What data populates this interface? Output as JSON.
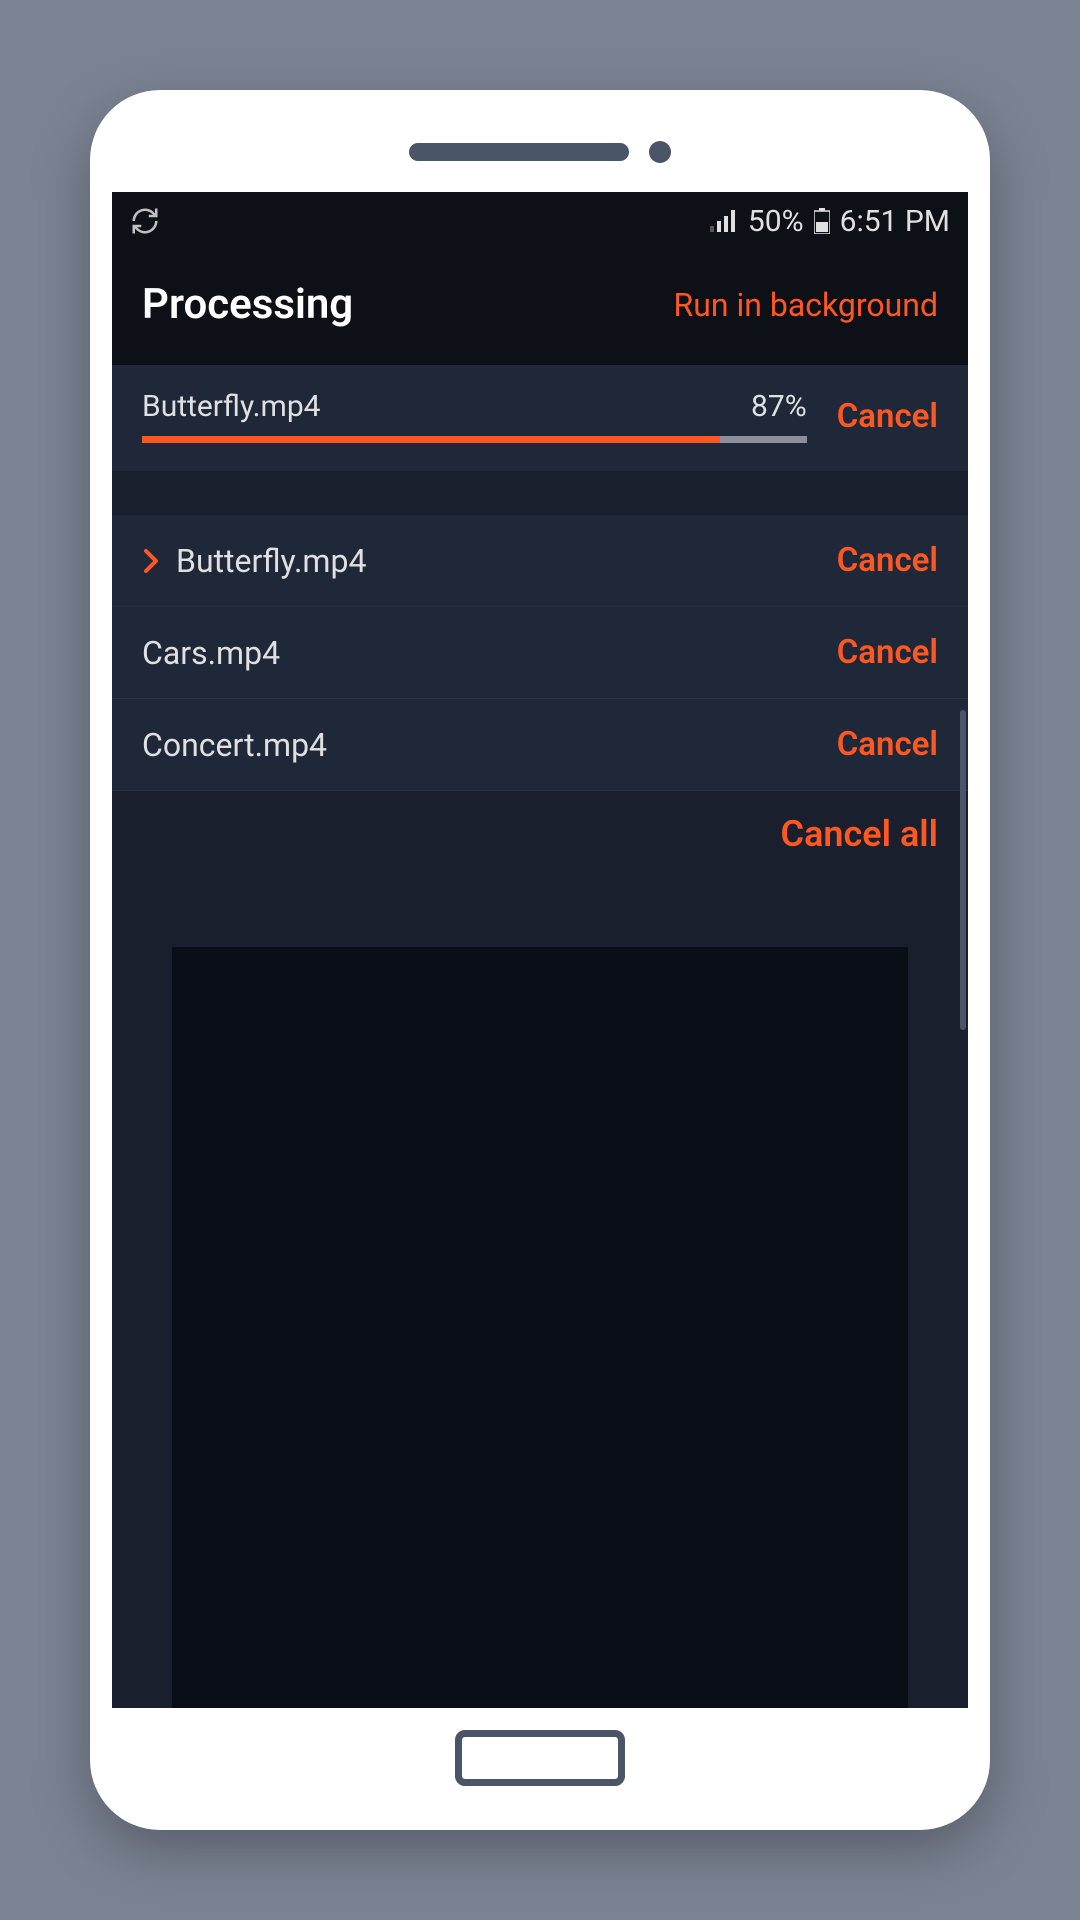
{
  "status_bar": {
    "battery_percent": "50%",
    "time": "6:51 PM"
  },
  "header": {
    "title": "Processing",
    "action": "Run in background"
  },
  "current": {
    "filename": "Butterfly.mp4",
    "percent_label": "87%",
    "percent_value": 87,
    "cancel_label": "Cancel"
  },
  "queue": [
    {
      "filename": "Butterfly.mp4",
      "cancel_label": "Cancel",
      "active": true
    },
    {
      "filename": "Cars.mp4",
      "cancel_label": "Cancel",
      "active": false
    },
    {
      "filename": "Concert.mp4",
      "cancel_label": "Cancel",
      "active": false
    }
  ],
  "cancel_all_label": "Cancel all"
}
